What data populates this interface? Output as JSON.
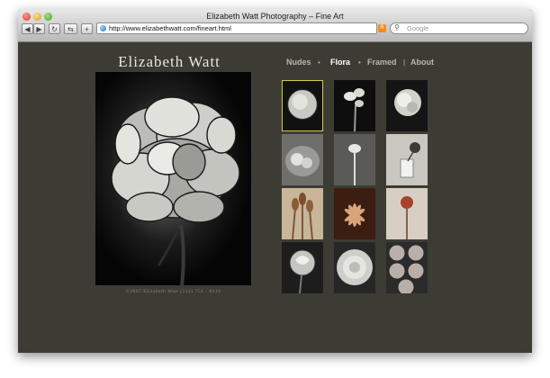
{
  "window": {
    "title": "Elizabeth Watt Photography – Fine Art"
  },
  "toolbar": {
    "back_icon": "back-arrow-icon",
    "forward_icon": "forward-arrow-icon",
    "reload_icon": "reload-icon",
    "add_icon": "plus-icon"
  },
  "address_bar": {
    "url": "http://www.elizabethwatt.com/fineart.html"
  },
  "search": {
    "placeholder": "Google"
  },
  "site": {
    "brand": "Elizabeth Watt",
    "nav": [
      {
        "label": "Nudes",
        "active": false
      },
      {
        "label": "Flora",
        "active": true
      },
      {
        "label": "Framed",
        "active": false
      },
      {
        "label": "About",
        "active": false
      }
    ],
    "footer": "©2007  Elizabeth Watt  (212) 751 - 8316"
  },
  "gallery": {
    "selected_index": 0,
    "thumbnails": [
      {
        "subject": "peony"
      },
      {
        "subject": "narcissus"
      },
      {
        "subject": "carnation"
      },
      {
        "subject": "bowl of roses"
      },
      {
        "subject": "stem in vase"
      },
      {
        "subject": "flower in glass"
      },
      {
        "subject": "tulip buds"
      },
      {
        "subject": "lotus"
      },
      {
        "subject": "poppy pod"
      },
      {
        "subject": "rose bud"
      },
      {
        "subject": "white rose"
      },
      {
        "subject": "rose heads"
      }
    ]
  }
}
